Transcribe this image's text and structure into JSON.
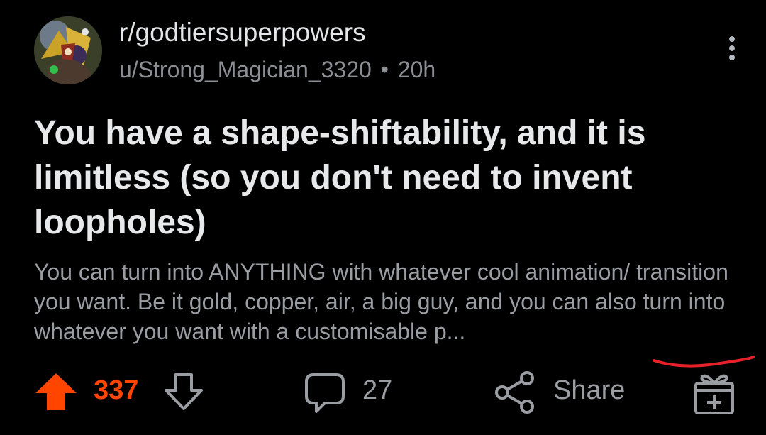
{
  "post": {
    "subreddit": "r/godtiersuperpowers",
    "author": "u/Strong_Magician_3320",
    "separator": "•",
    "age": "20h",
    "title": "You have a shape-shiftability, and it is limitless (so you don't need to invent loopholes)",
    "body": "You can turn into ANYTHING with whatever cool animation/ transition you want. Be it gold, copper, air, a big guy, and you can also turn into whatever you want with a customisable p..."
  },
  "actions": {
    "score": "337",
    "comments": "27",
    "share_label": "Share"
  },
  "colors": {
    "background": "#000000",
    "upvote_active": "#ff4500",
    "annotation": "#e8202a",
    "muted_text": "#9a9ea3"
  },
  "icons": {
    "avatar": "subreddit-avatar",
    "more": "more-vertical-icon",
    "upvote": "upvote-arrow-icon",
    "downvote": "downvote-arrow-icon",
    "comment": "comment-bubble-icon",
    "share": "share-icon",
    "award": "gift-award-icon"
  }
}
